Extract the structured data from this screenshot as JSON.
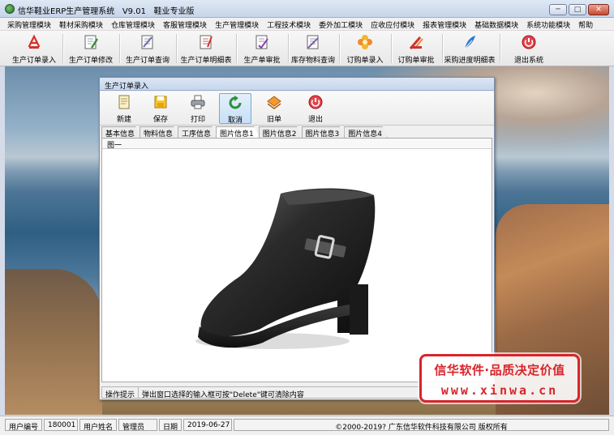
{
  "window": {
    "title": "信华鞋业ERP生产管理系统   V9.01   鞋业专业版",
    "min": "─",
    "max": "□",
    "close": "✕"
  },
  "menu": [
    "采购管理模块",
    "鞋材采购模块",
    "仓库管理模块",
    "客服管理模块",
    "生产管理模块",
    "工程技术模块",
    "委外加工模块",
    "应收应付模块",
    "报表管理模块",
    "基础数据模块",
    "系统功能模块",
    "帮助"
  ],
  "toolbar": [
    {
      "label": "生产订单录入",
      "icon": "pdf-icon",
      "color": "#d0332b"
    },
    {
      "label": "生产订单修改",
      "icon": "edit-doc-icon",
      "color": "#3b8d3a"
    },
    {
      "label": "生产订单查询",
      "icon": "query-doc-icon",
      "color": "#6b6bb0"
    },
    {
      "label": "生产订单明细表",
      "icon": "detail-doc-icon",
      "color": "#d0332b"
    },
    {
      "label": "生产单审批",
      "icon": "approve-doc-icon",
      "color": "#8b3fae"
    },
    {
      "label": "库存物料查询",
      "icon": "inventory-icon",
      "color": "#7d5fa8"
    },
    {
      "label": "订购单录入",
      "icon": "flower-icon",
      "color": "#f0a020"
    },
    {
      "label": "订购单审批",
      "icon": "pen-icon",
      "color": "#d0332b"
    },
    {
      "label": "采购进度明细表",
      "icon": "feather-icon",
      "color": "#2c7ad6"
    },
    {
      "label": "退出系统",
      "icon": "exit-icon",
      "color": "#e0454b"
    }
  ],
  "child": {
    "title": "生产订单录入",
    "buttons": [
      {
        "label": "新建",
        "icon": "new-doc-icon"
      },
      {
        "label": "保存",
        "icon": "save-icon"
      },
      {
        "label": "打印",
        "icon": "print-icon"
      },
      {
        "label": "取消",
        "icon": "cancel-icon"
      },
      {
        "label": "旧单",
        "icon": "old-order-icon"
      },
      {
        "label": "退出",
        "icon": "exit-icon"
      }
    ],
    "tabs": [
      "基本信息",
      "物料信息",
      "工序信息",
      "图片信息1",
      "图片信息2",
      "图片信息3",
      "图片信息4"
    ],
    "panel_label": "图一",
    "hint_label": "操作提示",
    "hint_text": "弹出窗口选择的输入框可按\"Delete\"键可清除内容"
  },
  "stamp": {
    "line1": "信华软件·品质决定价值",
    "line2": "www.xinwa.cn"
  },
  "status": {
    "user_id_label": "用户编号",
    "user_id": "180001",
    "user_name_label": "用户姓名",
    "user_name": "管理员",
    "date_label": "日期",
    "date": "2019-06-27",
    "copyright": "©2000-2019?   广东信华软件科技有限公司   版权所有"
  }
}
